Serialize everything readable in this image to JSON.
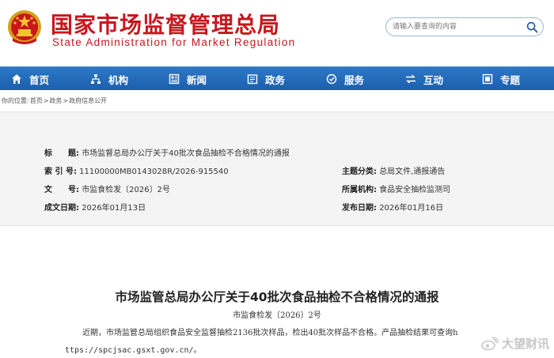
{
  "header": {
    "title_cn": "国家市场监督管理总局",
    "title_en": "State Administration for Market Regulation",
    "brand_color": "#c8161d",
    "emblem_icon": "national-emblem-icon"
  },
  "search": {
    "placeholder": "请输入要查询的内容",
    "icon": "search-icon"
  },
  "nav": {
    "background": "#1f66b5",
    "items": [
      {
        "label": "首页",
        "icon": "home-icon"
      },
      {
        "label": "机构",
        "icon": "org-chart-icon"
      },
      {
        "label": "新闻",
        "icon": "newspaper-icon"
      },
      {
        "label": "政务",
        "icon": "government-affairs-icon"
      },
      {
        "label": "服务",
        "icon": "service-icon"
      },
      {
        "label": "互动",
        "icon": "interaction-icon"
      },
      {
        "label": "专题",
        "icon": "topic-icon"
      }
    ]
  },
  "breadcrumb": {
    "prefix": "你的位置:",
    "items": [
      "首页",
      "政务",
      "政府信息公开"
    ],
    "separator": ">"
  },
  "meta": {
    "title_label": "标　　题:",
    "title_value": "市场监督总局办公厅关于40批次食品抽检不合格情况的通报",
    "index_label": "索 引 号:",
    "index_value": "11100000MB0143028R/2026-915540",
    "category_label": "主题分类:",
    "category_value": "总局文件,通报通告",
    "docno_label": "文　　号:",
    "docno_value": "市监食检发〔2026〕2号",
    "org_label": "所属机构:",
    "org_value": "食品安全抽检监测司",
    "created_label": "成文日期:",
    "created_value": "2026年01月13日",
    "published_label": "发布日期:",
    "published_value": "2026年01月16日"
  },
  "article": {
    "title": "市场监管总局办公厅关于40批次食品抽检不合格情况的通报",
    "doc_no": "市监食检发〔2026〕2号",
    "paragraph": "近期，市场监管总局组织食品安全监督抽检2136批次样品，检出40批次样品不合格。产品抽检结果可查询h",
    "url": "ttps://spcjsac.gsxt.gov.cn/。"
  },
  "watermark": {
    "text": "大望财讯",
    "icon": "weibo-icon"
  }
}
